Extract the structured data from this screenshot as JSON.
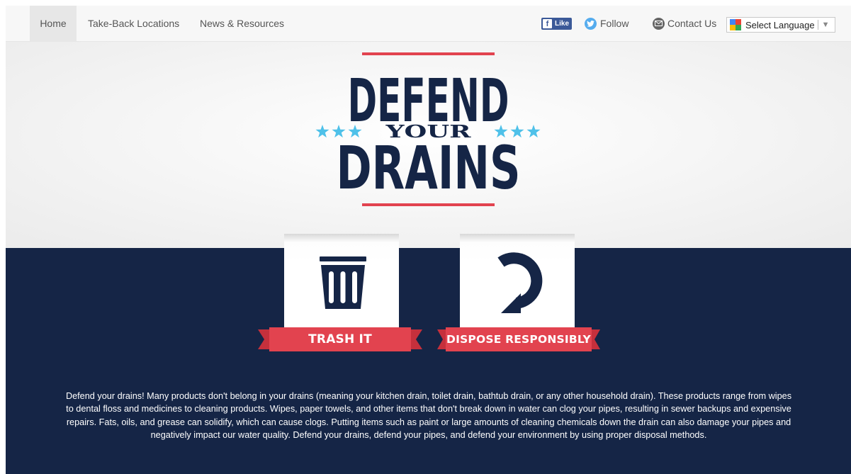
{
  "nav": {
    "home": "Home",
    "take_back": "Take-Back Locations",
    "news": "News & Resources",
    "facebook_like": "Like",
    "twitter_follow": "Follow",
    "contact": "Contact Us",
    "language_select": "Select Language",
    "active_item": "Home"
  },
  "logo": {
    "line1": "DEFEND",
    "line2": "YOUR",
    "line3": "DRAINS",
    "icons": [
      "star-icon"
    ]
  },
  "actions": {
    "trash_label": "TRASH IT",
    "trash_icon": "trash-can-icon",
    "dispose_label": "DISPOSE RESPONSIBLY",
    "dispose_icon": "circular-arrow-icon"
  },
  "description": "Defend your drains! Many products don't belong in your drains (meaning your kitchen drain, toilet drain, bathtub drain, or any other household drain). These products range from wipes to dental floss and medicines to cleaning products. Wipes, paper towels, and other items that don't break down in water can clog your pipes, resulting in sewer backups and expensive repairs. Fats, oils, and grease can solidify, which can cause clogs. Putting items such as paint or large amounts of cleaning chemicals down the drain can also damage your pipes and negatively impact our water quality. Defend your drains, defend your pipes, and defend your environment by using proper disposal methods.",
  "colors": {
    "navy": "#152546",
    "red": "#e2434f",
    "star_blue": "#4fc1e9",
    "facebook": "#3b5998",
    "twitter": "#55acee"
  }
}
